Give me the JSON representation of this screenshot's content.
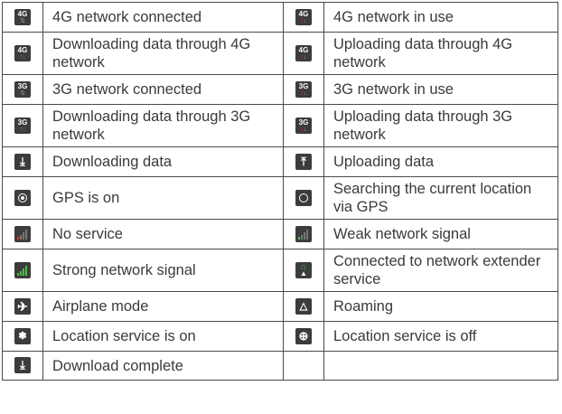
{
  "rows": [
    {
      "left": {
        "icon": "4g-connected-icon",
        "label": "4G network connected"
      },
      "right": {
        "icon": "4g-in-use-icon",
        "label": "4G network in use"
      }
    },
    {
      "left": {
        "icon": "4g-download-icon",
        "label": "Downloading data through 4G network"
      },
      "right": {
        "icon": "4g-upload-icon",
        "label": "Uploading data through 4G network"
      }
    },
    {
      "left": {
        "icon": "3g-connected-icon",
        "label": "3G network connected"
      },
      "right": {
        "icon": "3g-in-use-icon",
        "label": "3G network in use"
      }
    },
    {
      "left": {
        "icon": "3g-download-icon",
        "label": "Downloading data through 3G network"
      },
      "right": {
        "icon": "3g-upload-icon",
        "label": "Uploading data through 3G network"
      }
    },
    {
      "left": {
        "icon": "download-icon",
        "label": "Downloading data"
      },
      "right": {
        "icon": "upload-icon",
        "label": "Uploading data"
      }
    },
    {
      "left": {
        "icon": "gps-on-icon",
        "label": "GPS is on"
      },
      "right": {
        "icon": "gps-searching-icon",
        "label": "Searching the current location via GPS"
      }
    },
    {
      "left": {
        "icon": "no-service-icon",
        "label": "No service"
      },
      "right": {
        "icon": "weak-signal-icon",
        "label": "Weak network signal"
      }
    },
    {
      "left": {
        "icon": "strong-signal-icon",
        "label": "Strong network signal"
      },
      "right": {
        "icon": "network-extender-icon",
        "label": "Connected to network extender service"
      }
    },
    {
      "left": {
        "icon": "airplane-mode-icon",
        "label": "Airplane mode"
      },
      "right": {
        "icon": "roaming-icon",
        "label": "Roaming"
      }
    },
    {
      "left": {
        "icon": "location-on-icon",
        "label": "Location service is on"
      },
      "right": {
        "icon": "location-off-icon",
        "label": "Location service is off"
      }
    },
    {
      "left": {
        "icon": "download-complete-icon",
        "label": "Download complete"
      },
      "right": null
    }
  ],
  "icon_text": {
    "g4": "4G",
    "g3": "3G"
  },
  "colors": {
    "icon_bg": "#3c3c3c",
    "up_arrow": "#e8342c",
    "down_arrow": "#3aa0e8",
    "signal_green": "#48c048",
    "signal_red": "#e03030",
    "border": "#4a4a4a",
    "text": "#3a3a3a"
  }
}
